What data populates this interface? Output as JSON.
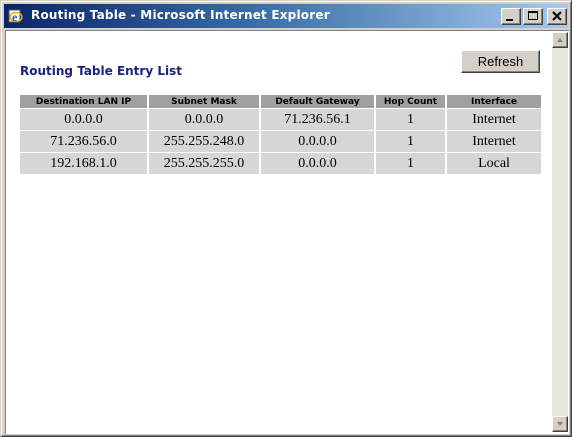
{
  "window": {
    "title": "Routing Table - Microsoft Internet Explorer"
  },
  "page": {
    "heading": "Routing Table Entry List",
    "refresh_label": "Refresh"
  },
  "table": {
    "headers": [
      "Destination LAN IP",
      "Subnet Mask",
      "Default Gateway",
      "Hop Count",
      "Interface"
    ],
    "rows": [
      [
        "0.0.0.0",
        "0.0.0.0",
        "71.236.56.1",
        "1",
        "Internet"
      ],
      [
        "71.236.56.0",
        "255.255.248.0",
        "0.0.0.0",
        "1",
        "Internet"
      ],
      [
        "192.168.1.0",
        "255.255.255.0",
        "0.0.0.0",
        "1",
        "Local"
      ]
    ]
  },
  "icons": {
    "app": "ie-icon",
    "minimize": "minimize-icon",
    "maximize": "maximize-icon",
    "close": "close-icon",
    "scroll_up": "arrow-up-icon",
    "scroll_down": "arrow-down-icon"
  },
  "colors": {
    "title_gradient_start": "#0a246a",
    "title_gradient_end": "#a6caf0",
    "heading_text": "#1a237e",
    "header_cell_bg": "#a0a0a0",
    "data_cell_bg": "#d6d6d6"
  }
}
